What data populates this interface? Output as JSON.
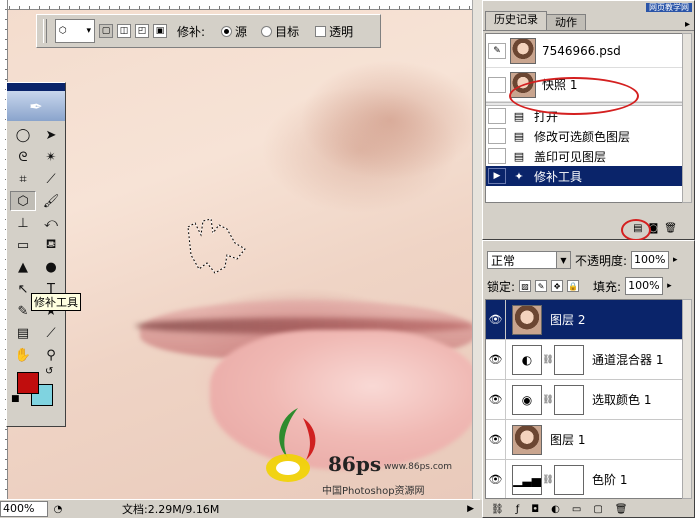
{
  "options_bar": {
    "patch_label": "修补:",
    "source_label": "源",
    "destination_label": "目标",
    "transparent_label": "透明",
    "patch_mode": "source",
    "transparent_checked": false
  },
  "toolbox": {
    "tooltip": "修补工具",
    "foreground_color": "#c00d0d",
    "background_color": "#7fd3e0"
  },
  "status_bar": {
    "zoom": "400%",
    "doc_info": "文档:2.29M/9.16M"
  },
  "watermark": {
    "brand_text": "86ps",
    "url": "www.86ps.com",
    "cn_text": "中国Photoshop资源网",
    "corner_tag": "网页教学网"
  },
  "history_panel": {
    "tabs": [
      {
        "label": "历史记录",
        "active": true
      },
      {
        "label": "动作",
        "active": false
      }
    ],
    "snapshots": [
      {
        "label": "7546966.psd"
      },
      {
        "label": "快照 1"
      }
    ],
    "steps": [
      {
        "label": "打开",
        "selected": false
      },
      {
        "label": "修改可选颜色图层",
        "selected": false
      },
      {
        "label": "盖印可见图层",
        "selected": false
      },
      {
        "label": "修补工具",
        "selected": true
      }
    ]
  },
  "layers_panel": {
    "blend_mode": "正常",
    "opacity_label": "不透明度:",
    "opacity_value": "100%",
    "lock_label": "锁定:",
    "fill_label": "填充:",
    "fill_value": "100%",
    "layers": [
      {
        "name": "图层 2",
        "kind": "photo",
        "selected": true
      },
      {
        "name": "通道混合器 1",
        "kind": "adjustment",
        "selected": false
      },
      {
        "name": "选取颜色 1",
        "kind": "adjustment",
        "selected": false
      },
      {
        "name": "图层 1",
        "kind": "photo",
        "selected": false
      },
      {
        "name": "色阶 1",
        "kind": "adjustment",
        "selected": false
      }
    ]
  }
}
